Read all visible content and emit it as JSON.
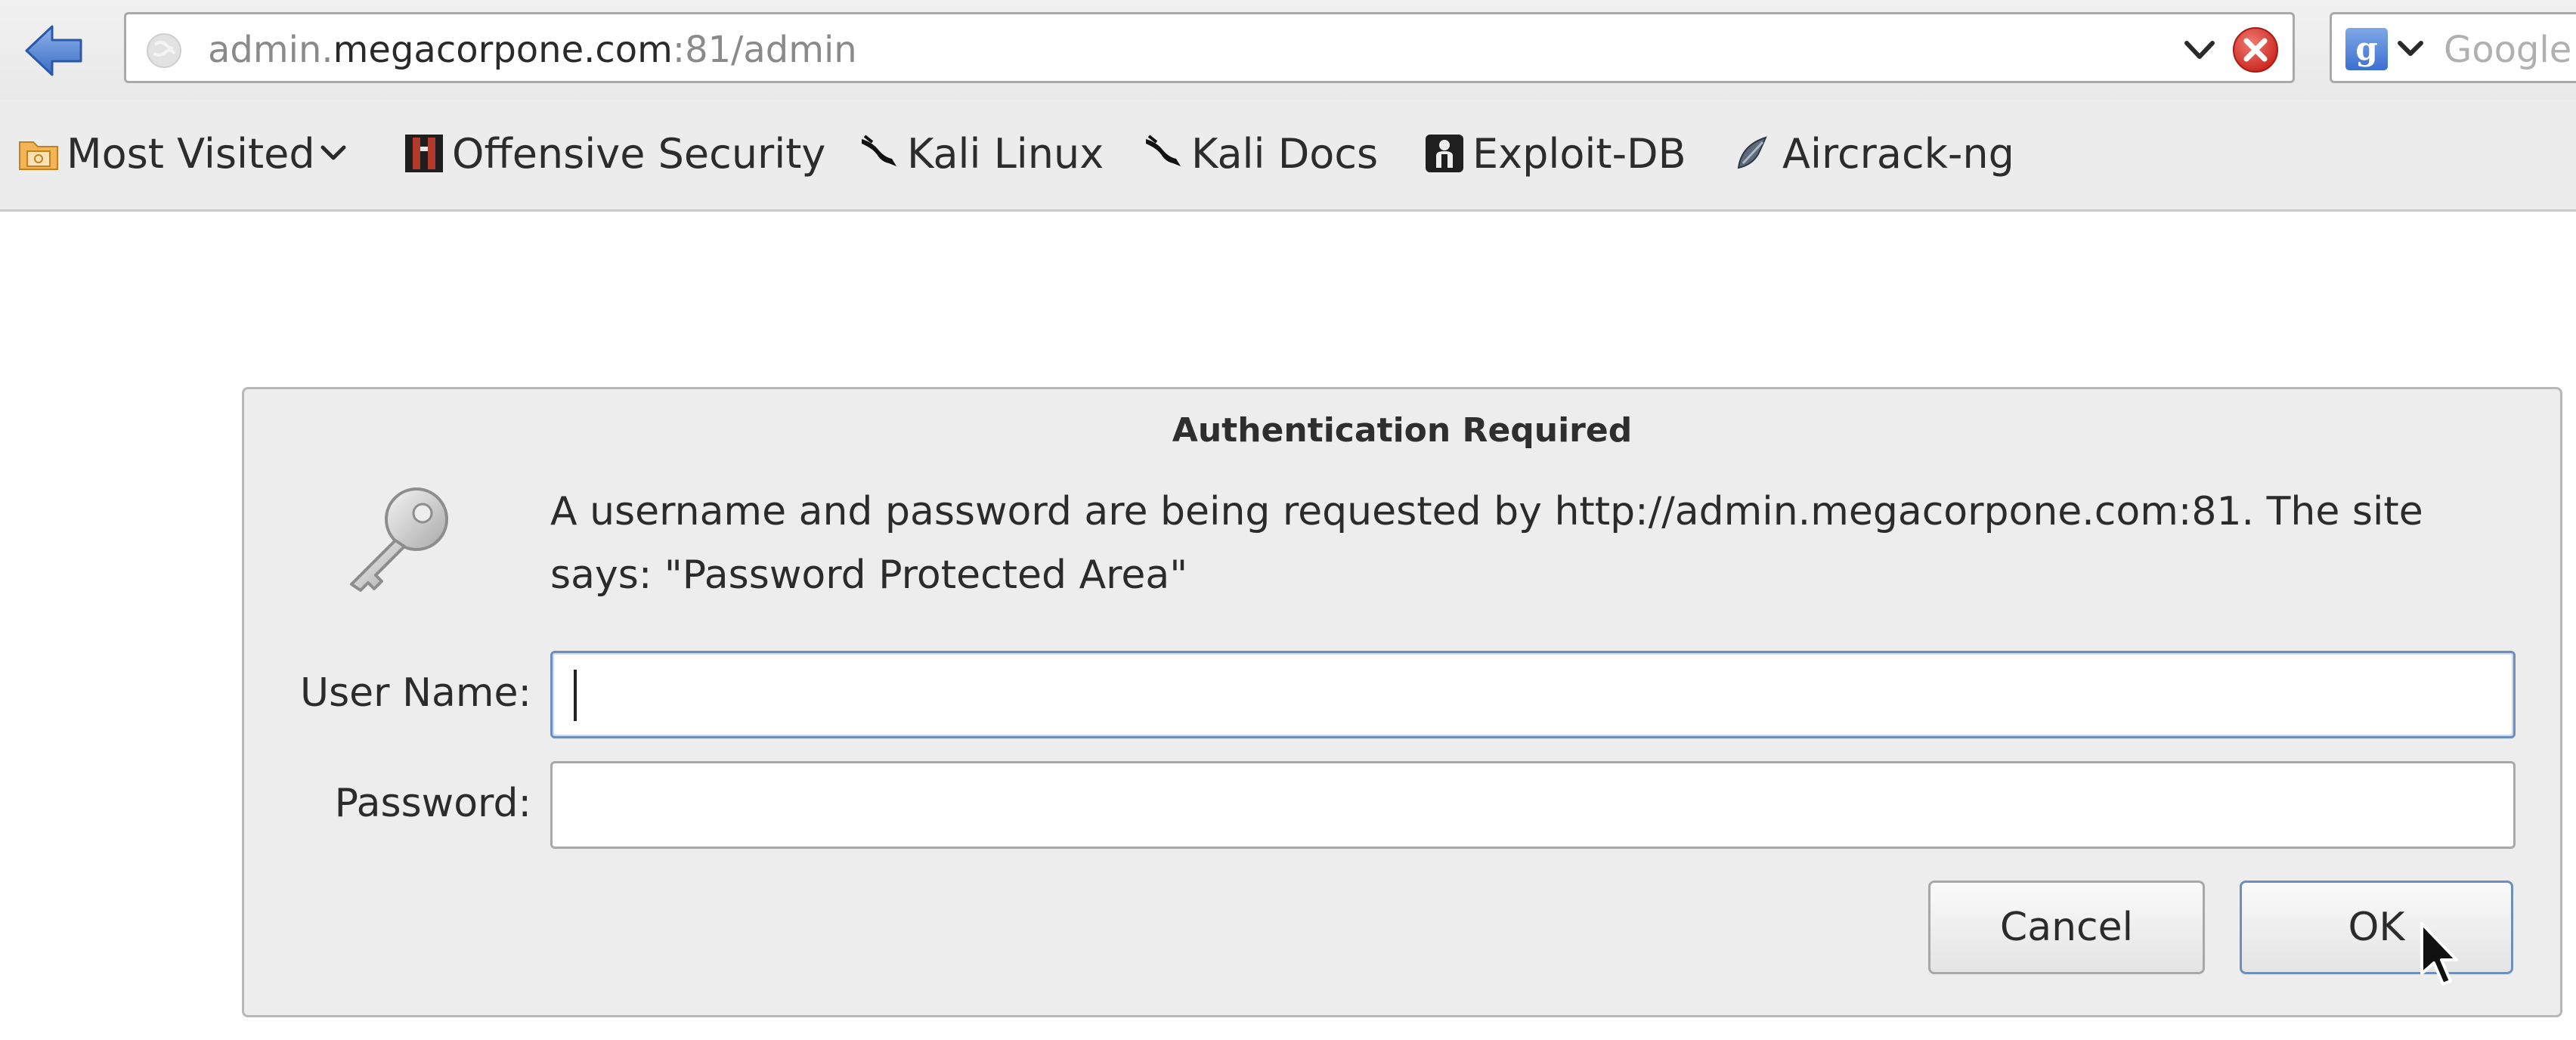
{
  "browser": {
    "url": {
      "subdomain": "admin.",
      "host": "megacorpone.com",
      "suffix": ":81/admin"
    },
    "search": {
      "engine_icon": "g",
      "placeholder": "Google"
    }
  },
  "bookmarks": [
    {
      "label": "Most Visited",
      "icon": "folder-icon"
    },
    {
      "label": "Offensive Security",
      "icon": "offsec-icon"
    },
    {
      "label": "Kali Linux",
      "icon": "kali-dragon-icon"
    },
    {
      "label": "Kali Docs",
      "icon": "kali-dragon-icon"
    },
    {
      "label": "Exploit-DB",
      "icon": "exploitdb-icon"
    },
    {
      "label": "Aircrack-ng",
      "icon": "aircrack-icon"
    }
  ],
  "dialog": {
    "title": "Authentication Required",
    "message": "A username and password are being requested by http://admin.megacorpone.com:81. The site says: \"Password Protected Area\"",
    "username_label": "User Name:",
    "username_value": "",
    "password_label": "Password:",
    "password_value": "",
    "cancel_label": "Cancel",
    "ok_label": "OK"
  },
  "colors": {
    "toolbar_bg": "#ececec",
    "dialog_bg": "#ededed",
    "focus_border": "#6d8fbd",
    "back_arrow": "#4a7fd0",
    "stop_red": "#d9342b"
  }
}
